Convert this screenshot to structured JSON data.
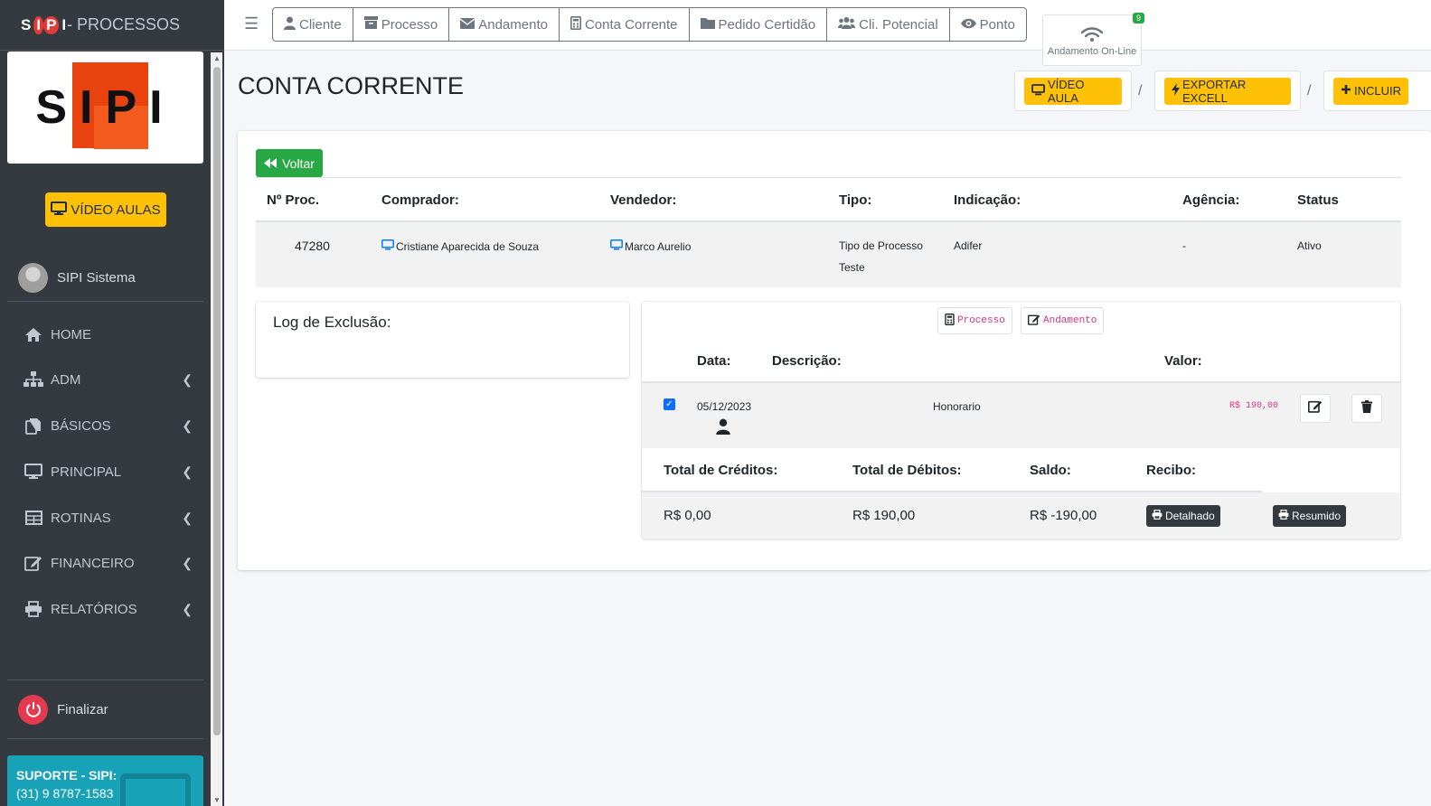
{
  "brand": {
    "mini": [
      "S",
      "I",
      "P",
      "I"
    ],
    "title": "- PROCESSOS"
  },
  "logo_text": "SIPI",
  "sidebar": {
    "video_btn": "VÍDEO AULAS",
    "user": "SIPI Sistema",
    "items": [
      {
        "label": "HOME",
        "icon": "home-icon",
        "chevron": false
      },
      {
        "label": "ADM",
        "icon": "sitemap-icon",
        "chevron": true
      },
      {
        "label": "BÁSICOS",
        "icon": "copy-icon",
        "chevron": true
      },
      {
        "label": "PRINCIPAL",
        "icon": "desktop-icon",
        "chevron": true
      },
      {
        "label": "ROTINAS",
        "icon": "table-icon",
        "chevron": true
      },
      {
        "label": "FINANCEIRO",
        "icon": "edit-icon",
        "chevron": true
      },
      {
        "label": "RELATÓRIOS",
        "icon": "print-icon",
        "chevron": true
      }
    ],
    "logout": "Finalizar",
    "support_title": "SUPORTE - SIPI:",
    "support_phone": "(31) 9 8787-1583"
  },
  "topnav": [
    "Cliente",
    "Processo",
    "Andamento",
    "Conta Corrente",
    "Pedido Certidão",
    "Cli. Potencial",
    "Ponto"
  ],
  "online": {
    "label": "Andamento On-Line",
    "badge": "9"
  },
  "page": {
    "title": "CONTA CORRENTE",
    "video": "VÍDEO AULA",
    "export": "EXPORTAR EXCELL",
    "include": "INCLUIR",
    "sep": "/",
    "back": "Voltar"
  },
  "process": {
    "headers": [
      "Nº Proc.",
      "Comprador:",
      "Vendedor:",
      "Tipo:",
      "Indicação:",
      "Agência:",
      "Status"
    ],
    "row": {
      "num": "47280",
      "comprador": "Cristiane Aparecida de Souza",
      "vendedor": "Marco Aurelio",
      "tipo1": "Tipo de Processo",
      "tipo2": "Teste",
      "indicacao": "Adifer",
      "agencia": "-",
      "status": "Ativo"
    }
  },
  "log": {
    "title": "Log de Exclusão:"
  },
  "ledger": {
    "btn_processo": "Processo",
    "btn_andamento": "Andamento",
    "headers": {
      "data": "Data:",
      "descricao": "Descrição:",
      "valor": "Valor:"
    },
    "row": {
      "data": "05/12/2023",
      "descricao": "Honorario",
      "valor": "R$ 190,00",
      "checked": true
    },
    "summary_headers": [
      "Total de Créditos:",
      "Total de Débitos:",
      "Saldo:",
      "Recibo:"
    ],
    "summary": {
      "creditos": "R$ 0,00",
      "debitos": "R$ 190,00",
      "saldo": "R$ -190,00",
      "detalhado": "Detalhado",
      "resumido": "Resumido"
    }
  },
  "colors": {
    "sidebar": "#343a40",
    "accent": "#ffc107",
    "success": "#28a745",
    "danger": "#e53950",
    "info": "#17a2b8",
    "code": "#d63384"
  }
}
